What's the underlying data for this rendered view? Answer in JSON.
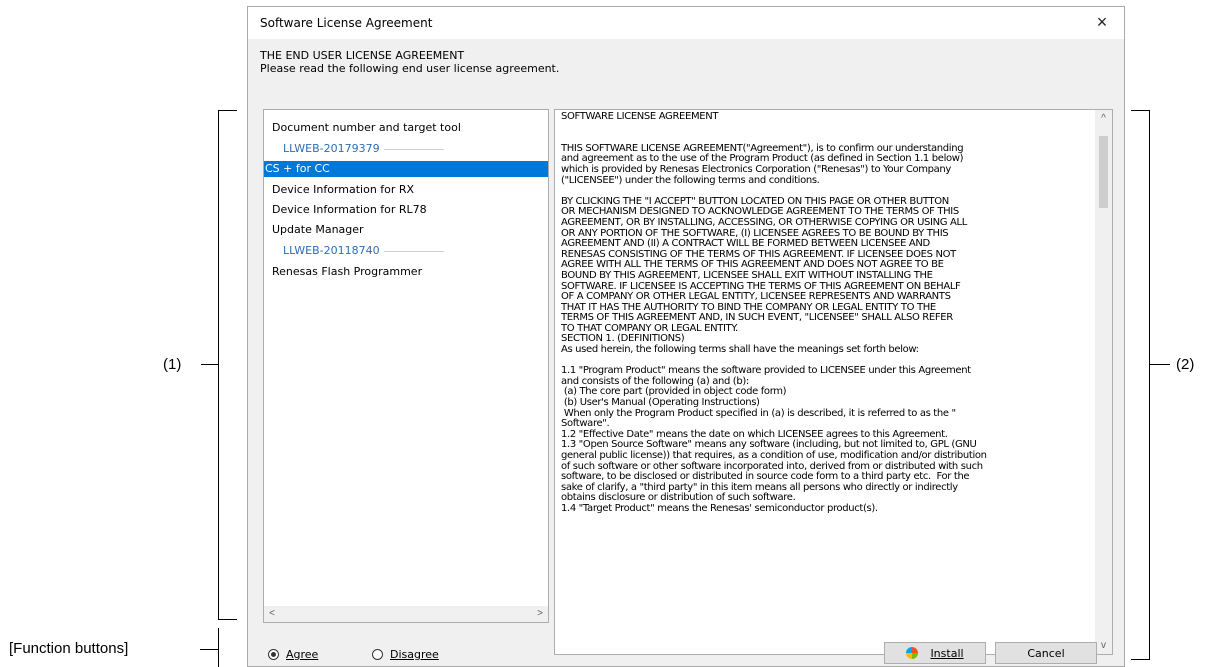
{
  "dialog": {
    "title": "Software License Agreement",
    "close_icon": "×",
    "header_title": "THE END USER LICENSE AGREEMENT",
    "header_subtitle": "Please read the following end user license agreement."
  },
  "left_list": {
    "items": [
      {
        "kind": "header",
        "label": "Document number and target tool"
      },
      {
        "kind": "group",
        "label": "LLWEB-20179379"
      },
      {
        "kind": "item",
        "label": "CS + for CC",
        "selected": true
      },
      {
        "kind": "item",
        "label": "Device Information for RX"
      },
      {
        "kind": "item",
        "label": "Device Information for RL78"
      },
      {
        "kind": "item",
        "label": "Update Manager"
      },
      {
        "kind": "group",
        "label": "LLWEB-20118740"
      },
      {
        "kind": "item",
        "label": "Renesas Flash Programmer"
      }
    ],
    "scroll_left": "<",
    "scroll_right": ">"
  },
  "license": {
    "text": "SOFTWARE LICENSE AGREEMENT\n\n\nTHIS SOFTWARE LICENSE AGREEMENT(\"Agreement\"), is to confirm our understanding\nand agreement as to the use of the Program Product (as defined in Section 1.1 below)\nwhich is provided by Renesas Electronics Corporation (\"Renesas\") to Your Company\n(\"LICENSEE\") under the following terms and conditions.\n\nBY CLICKING THE \"I ACCEPT\" BUTTON LOCATED ON THIS PAGE OR OTHER BUTTON\nOR MECHANISM DESIGNED TO ACKNOWLEDGE AGREEMENT TO THE TERMS OF THIS\nAGREEMENT, OR BY INSTALLING, ACCESSING, OR OTHERWISE COPYING OR USING ALL\nOR ANY PORTION OF THE SOFTWARE, (I) LICENSEE AGREES TO BE BOUND BY THIS\nAGREEMENT AND (II) A CONTRACT WILL BE FORMED BETWEEN LICENSEE AND\nRENESAS CONSISTING OF THE TERMS OF THIS AGREEMENT. IF LICENSEE DOES NOT\nAGREE WITH ALL THE TERMS OF THIS AGREEMENT AND DOES NOT AGREE TO BE\nBOUND BY THIS AGREEMENT, LICENSEE SHALL EXIT WITHOUT INSTALLING THE\nSOFTWARE. IF LICENSEE IS ACCEPTING THE TERMS OF THIS AGREEMENT ON BEHALF\nOF A COMPANY OR OTHER LEGAL ENTITY, LICENSEE REPRESENTS AND WARRANTS\nTHAT IT HAS THE AUTHORITY TO BIND THE COMPANY OR LEGAL ENTITY TO THE\nTERMS OF THIS AGREEMENT AND, IN SUCH EVENT, \"LICENSEE\" SHALL ALSO REFER\nTO THAT COMPANY OR LEGAL ENTITY.\nSECTION 1. (DEFINITIONS)\nAs used herein, the following terms shall have the meanings set forth below:\n\n1.1 \"Program Product\" means the software provided to LICENSEE under this Agreement\nand consists of the following (a) and (b):\n (a) The core part (provided in object code form)\n (b) User's Manual (Operating Instructions)\n When only the Program Product specified in (a) is described, it is referred to as the \"\nSoftware\".\n1.2 \"Effective Date\" means the date on which LICENSEE agrees to this Agreement.\n1.3 \"Open Source Software\" means any software (including, but not limited to, GPL (GNU\ngeneral public license)) that requires, as a condition of use, modification and/or distribution\nof such software or other software incorporated into, derived from or distributed with such\nsoftware, to be disclosed or distributed in source code form to a third party etc.  For the\nsake of clarify, a \"third party\" in this item means all persons who directly or indirectly\nobtains disclosure or distribution of such software.\n1.4 \"Target Product\" means the Renesas' semiconductor product(s).",
    "scroll_up": "^",
    "scroll_down": "v"
  },
  "footer": {
    "agree_label": "Agree",
    "disagree_label": "Disagree",
    "agree_selected": true,
    "install_label": "Install",
    "cancel_label": "Cancel",
    "install_icon": "shield-icon"
  },
  "annotations": {
    "left": "(1)",
    "right": "(2)",
    "bottom": "[Function buttons]"
  }
}
